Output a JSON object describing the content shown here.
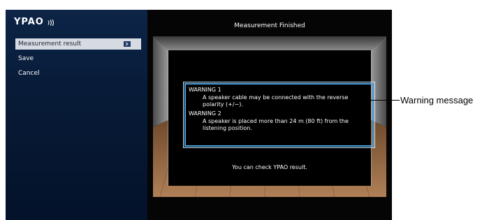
{
  "brand": {
    "name": "YPAO",
    "icon": "sound-waves-icon"
  },
  "menu": {
    "items": [
      {
        "label": "Measurement result",
        "selected": true,
        "icon": "enter-icon"
      },
      {
        "label": "Save",
        "selected": false
      },
      {
        "label": "Cancel",
        "selected": false
      }
    ]
  },
  "content": {
    "title": "Measurement Finished",
    "warnings": [
      {
        "title": "WARNING 1",
        "body": "A speaker cable may be connected with the reverse polarity (+/−)."
      },
      {
        "title": "WARNING 2",
        "body": "A speaker is placed more than 24 m (80 ft) from the listening position."
      }
    ],
    "footer": "You can check YPAO result."
  },
  "callout": {
    "label": "Warning message"
  },
  "colors": {
    "highlight_border": "#4aa3e0",
    "sidebar": "#0a1f3f",
    "selected_bg": "#d6dbe3"
  }
}
